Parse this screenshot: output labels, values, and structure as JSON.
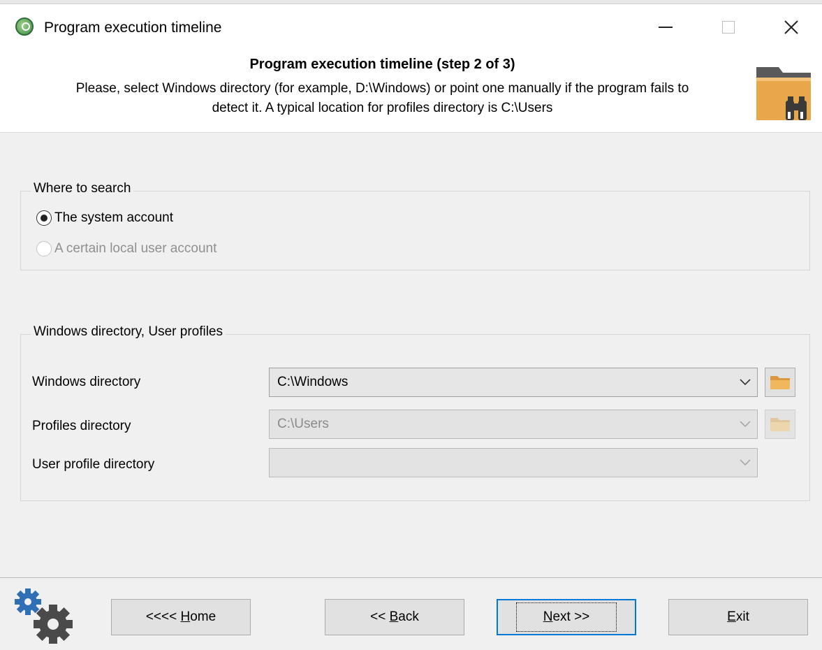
{
  "window": {
    "title": "Program execution timeline",
    "icon": "app-icon"
  },
  "header": {
    "title": "Program execution timeline (step 2 of 3)",
    "description_line1": "Please, select Windows directory (for example, D:\\Windows) or point one manually if the program fails to",
    "description_line2": "detect it. A typical location for profiles directory is C:\\Users",
    "art_icon": "folder-binoculars-icon"
  },
  "where_to_search": {
    "legend": "Where to search",
    "options": [
      {
        "label": "The system account",
        "checked": true,
        "enabled": true
      },
      {
        "label": "A certain local user account",
        "checked": false,
        "enabled": false
      }
    ]
  },
  "directories": {
    "legend": "Windows directory, User profiles",
    "fields": [
      {
        "label": "Windows directory",
        "value": "C:\\Windows",
        "enabled": true,
        "has_browse": true
      },
      {
        "label": "Profiles directory",
        "value": "C:\\Users",
        "enabled": false,
        "has_browse": true
      },
      {
        "label": "User profile directory",
        "value": "",
        "enabled": false,
        "has_browse": false
      }
    ]
  },
  "footer": {
    "icon": "gears-icon",
    "buttons": {
      "home_prefix": "<<<< ",
      "home_mnemonic": "H",
      "home_rest": "ome",
      "back_prefix": "<< ",
      "back_mnemonic": "B",
      "back_rest": "ack",
      "next_mnemonic": "N",
      "next_rest": "ext >>",
      "exit_mnemonic": "E",
      "exit_rest": "xit"
    }
  },
  "colors": {
    "accent": "#0078d7",
    "folder": "#e9a74c",
    "gear": "#2f6fb6",
    "gear_dark": "#4a4a4a"
  }
}
